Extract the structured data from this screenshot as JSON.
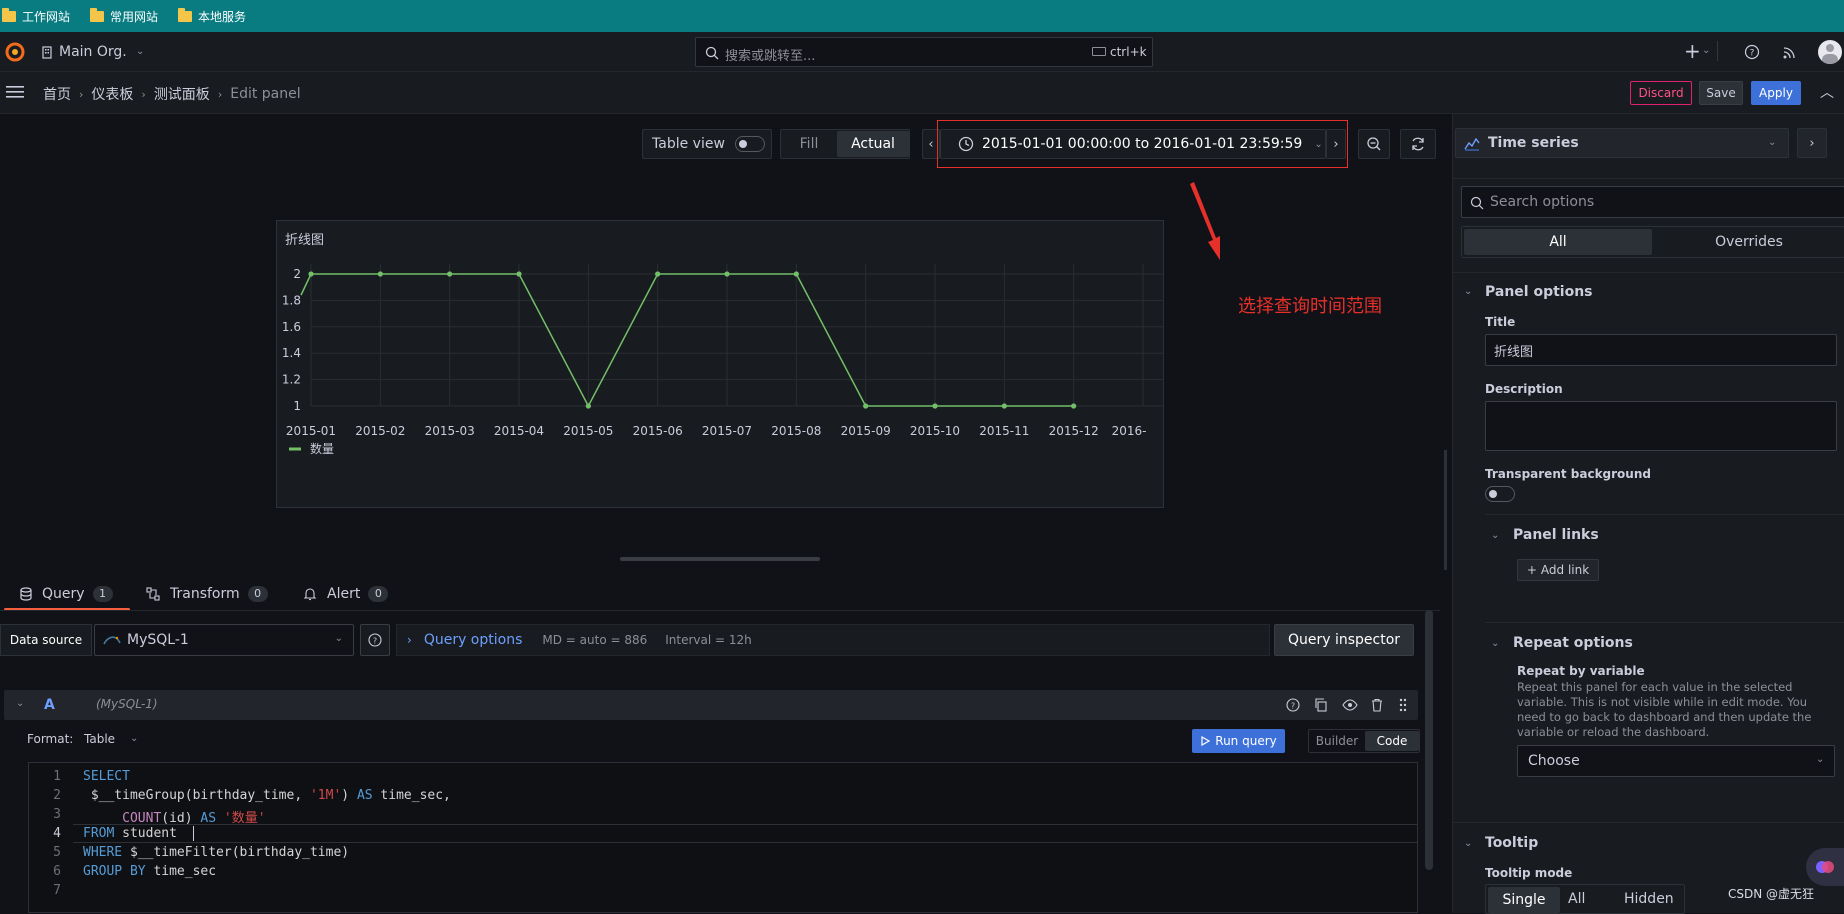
{
  "bookmarks": [
    {
      "label": "工作网站",
      "icon": "folder-icon"
    },
    {
      "label": "常用网站",
      "icon": "folder-icon"
    },
    {
      "label": "本地服务",
      "icon": "folder-icon"
    }
  ],
  "topnav": {
    "org": "Main Org.",
    "search_placeholder": "搜索或跳转至...",
    "shortcut": "ctrl+k"
  },
  "breadcrumb": {
    "items": [
      "首页",
      "仪表板",
      "测试面板",
      "Edit panel"
    ]
  },
  "actions": {
    "discard": "Discard",
    "save": "Save",
    "apply": "Apply"
  },
  "toolbar": {
    "table_view": "Table view",
    "fill": "Fill",
    "actual": "Actual",
    "time_range": "2015-01-01 00:00:00 to 2016-01-01 23:59:59",
    "accent": "#ff3b3b"
  },
  "annotation": {
    "text": "选择查询时间范围",
    "color": "#e8302a"
  },
  "panel": {
    "title": "折线图"
  },
  "chart_data": {
    "type": "line",
    "categories": [
      "2015-01",
      "2015-02",
      "2015-03",
      "2015-04",
      "2015-05",
      "2015-06",
      "2015-07",
      "2015-08",
      "2015-09",
      "2015-10",
      "2015-11",
      "2015-12",
      "2016-"
    ],
    "series": [
      {
        "name": "数量",
        "values": [
          2,
          2,
          2,
          2,
          1,
          2,
          2,
          2,
          1,
          1,
          1,
          1
        ],
        "color": "#73bf69"
      }
    ],
    "yticks": [
      "2",
      "1.8",
      "1.6",
      "1.4",
      "1.2",
      "1"
    ],
    "ylim": [
      1,
      2
    ],
    "legend": "bottom-left",
    "grid": true
  },
  "query_tabs": [
    {
      "label": "Query",
      "count": "1",
      "icon": "database-icon"
    },
    {
      "label": "Transform",
      "count": "0",
      "icon": "transform-icon"
    },
    {
      "label": "Alert",
      "count": "0",
      "icon": "bell-icon"
    }
  ],
  "datasource": {
    "label": "Data source",
    "value": "MySQL-1",
    "query_options": "Query options",
    "md": "MD = auto = 886",
    "interval": "Interval = 12h",
    "inspector": "Query inspector"
  },
  "query_row": {
    "letter": "A",
    "source": "(MySQL-1)",
    "format_label": "Format:",
    "format_value": "Table",
    "run": "Run query",
    "builder": "Builder",
    "code": "Code"
  },
  "code_lines": [
    {
      "n": "1",
      "parts": [
        {
          "t": "SELECT",
          "c": "kw"
        }
      ]
    },
    {
      "n": "2",
      "parts": [
        {
          "t": " $__timeGroup(birthday_time, ",
          "c": "plain"
        },
        {
          "t": "'1M'",
          "c": "str"
        },
        {
          "t": ") ",
          "c": "plain"
        },
        {
          "t": "AS",
          "c": "kw"
        },
        {
          "t": " time_sec,",
          "c": "plain"
        }
      ]
    },
    {
      "n": "3",
      "parts": [
        {
          "t": "     ",
          "c": "plain"
        },
        {
          "t": "COUNT",
          "c": "fn"
        },
        {
          "t": "(id) ",
          "c": "plain"
        },
        {
          "t": "AS",
          "c": "kw"
        },
        {
          "t": " ",
          "c": "plain"
        },
        {
          "t": "'数量'",
          "c": "str"
        }
      ]
    },
    {
      "n": "4",
      "parts": [
        {
          "t": "FROM",
          "c": "kw"
        },
        {
          "t": " student  ",
          "c": "plain"
        }
      ]
    },
    {
      "n": "5",
      "parts": [
        {
          "t": "WHERE",
          "c": "kw"
        },
        {
          "t": " $__timeFilter(birthday_time)",
          "c": "plain"
        }
      ]
    },
    {
      "n": "6",
      "parts": [
        {
          "t": "GROUP BY",
          "c": "kw"
        },
        {
          "t": " time_sec",
          "c": "plain"
        }
      ]
    },
    {
      "n": "7",
      "parts": []
    }
  ],
  "options": {
    "viz": "Time series",
    "search_placeholder": "Search options",
    "tab_all": "All",
    "tab_overrides": "Overrides",
    "panel_options": "Panel options",
    "title_label": "Title",
    "title_value": "折线图",
    "description_label": "Description",
    "transparent_label": "Transparent background",
    "panel_links": "Panel links",
    "add_link": "Add link",
    "repeat_options": "Repeat options",
    "repeat_by_variable": "Repeat by variable",
    "repeat_desc": "Repeat this panel for each value in the selected variable. This is not visible while in edit mode. You need to go back to dashboard and then update the variable or reload the dashboard.",
    "choose": "Choose",
    "tooltip": "Tooltip",
    "tooltip_mode": "Tooltip mode",
    "mode_single": "Single",
    "mode_all": "All",
    "mode_hidden": "Hidden"
  },
  "watermark": "CSDN @虚无狂"
}
